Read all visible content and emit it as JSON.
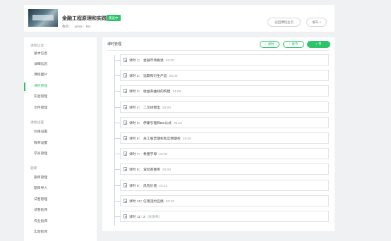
{
  "header": {
    "title": "金融工程原理和实践",
    "status": "建设中",
    "teacher_label": "教师：",
    "teachers": [
      "admin",
      "kks"
    ],
    "btn_home": "返回课程主页",
    "btn_publish": "发布 »"
  },
  "sidebar": {
    "groups": [
      {
        "label": "课程信息",
        "items": [
          "基本信息",
          "详细信息",
          "课程图片",
          "课时管理",
          "实验管理",
          "文件管理"
        ]
      },
      {
        "label": "课程设置",
        "items": [
          "价格设置",
          "教师设置",
          "学员管理"
        ]
      },
      {
        "label": "题库",
        "items": [
          "题目管理",
          "题目导入",
          "试卷管理",
          "试卷批阅",
          "作业批阅",
          "实验批阅"
        ]
      }
    ],
    "active": "课时管理"
  },
  "main": {
    "title": "课时管理",
    "btn_lesson": "+ 课时",
    "btn_chapter": "+ 章节",
    "btn_section": "+ 节",
    "lessons": [
      {
        "num": "课时 1：",
        "name": "金融市场概述",
        "dur": "20:00"
      },
      {
        "num": "课时 2：",
        "name": "远期和衍生产品",
        "dur": "25:00"
      },
      {
        "num": "课时 3：",
        "name": "收益率曲线的构建",
        "dur": "24:00"
      },
      {
        "num": "课时 4：",
        "name": "二叉树模型",
        "dur": "20:00"
      },
      {
        "num": "课时 5：",
        "name": "伊藤引理和BS公式",
        "dur": "30:12"
      },
      {
        "num": "课时 6：",
        "name": "员工股票期权和实物期权",
        "dur": "28:00"
      },
      {
        "num": "课时 7：",
        "name": "希腊字母",
        "dur": "20:00"
      },
      {
        "num": "课时 8：",
        "name": "波动率微笑",
        "dur": "20:00"
      },
      {
        "num": "课时 9：",
        "name": "风险价值",
        "dur": "23:22"
      },
      {
        "num": "课时 10：",
        "name": "信用违约互换",
        "dur": "30:22"
      },
      {
        "num": "课时 11：",
        "name": "2",
        "dur": "(未发布)"
      }
    ]
  },
  "colors": {
    "accent": "#2cc36b",
    "background": "#eff1f3"
  }
}
